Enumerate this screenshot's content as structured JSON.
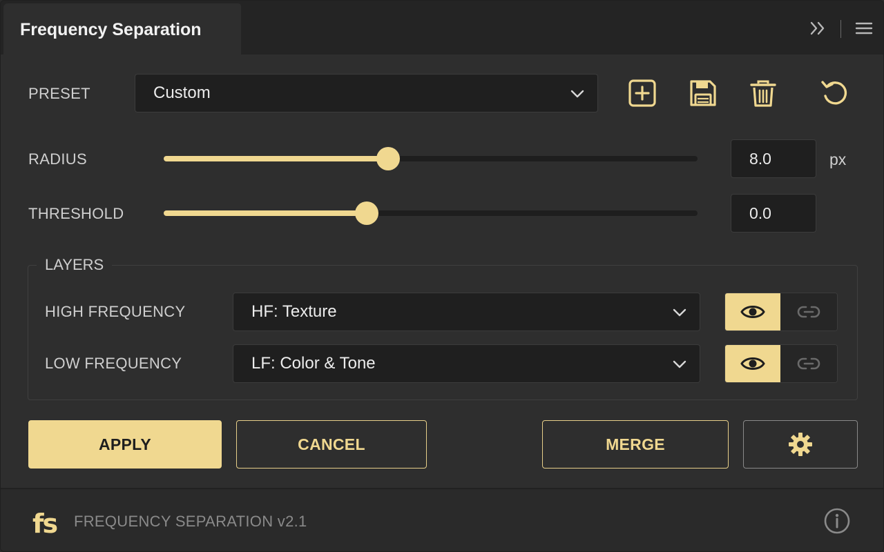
{
  "header": {
    "title": "Frequency Separation",
    "collapse_icon": "double-chevron-right-icon",
    "menu_icon": "hamburger-menu-icon"
  },
  "preset": {
    "label": "PRESET",
    "value": "Custom",
    "actions": [
      "add-preset-icon",
      "save-icon",
      "trash-icon",
      "reset-icon"
    ]
  },
  "radius": {
    "label": "RADIUS",
    "value": "8.0",
    "unit": "px",
    "slider_fraction": 0.42
  },
  "threshold": {
    "label": "THRESHOLD",
    "value": "0.0",
    "slider_fraction": 0.38
  },
  "layers": {
    "legend": "LAYERS",
    "high": {
      "label": "HIGH FREQUENCY",
      "value": "HF: Texture",
      "visible": true,
      "linked": false
    },
    "low": {
      "label": "LOW FREQUENCY",
      "value": "LF: Color & Tone",
      "visible": true,
      "linked": false
    }
  },
  "buttons": {
    "apply": "APPLY",
    "cancel": "CANCEL",
    "merge": "MERGE",
    "settings_icon": "gear-icon"
  },
  "footer": {
    "logo": "fs",
    "text": "FREQUENCY SEPARATION v2.1",
    "info_icon": "info-icon"
  },
  "colors": {
    "accent": "#f0d890",
    "panel": "#2e2e2e",
    "input": "#1f1f1f"
  }
}
